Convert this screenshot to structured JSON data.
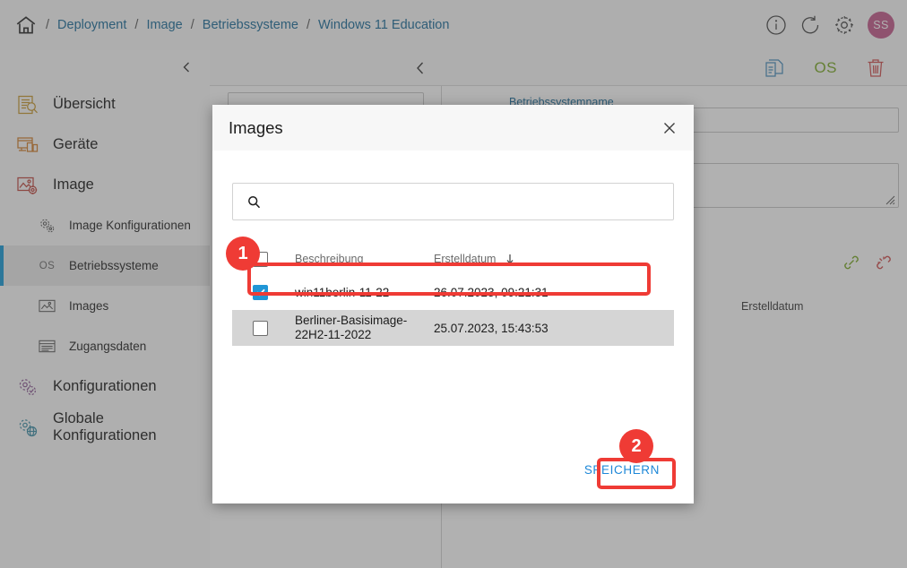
{
  "breadcrumb": {
    "home_icon": "home-icon",
    "separator": "/",
    "items": [
      {
        "label": "Deployment"
      },
      {
        "label": "Image"
      },
      {
        "label": "Betriebssysteme"
      },
      {
        "label": "Windows 11 Education"
      }
    ]
  },
  "topbar": {
    "icons": [
      {
        "name": "info-icon"
      },
      {
        "name": "refresh-icon"
      },
      {
        "name": "gear-icon"
      }
    ],
    "avatar_initials": "SS",
    "avatar_color": "#c45d8d"
  },
  "sidebar": {
    "collapse_icon": "chevron-left-icon",
    "items": [
      {
        "label": "Übersicht",
        "icon": "document-search-icon",
        "level": 1,
        "active": false
      },
      {
        "label": "Geräte",
        "icon": "devices-icon",
        "level": 1,
        "active": false
      },
      {
        "label": "Image",
        "icon": "image-gear-icon",
        "level": 1,
        "active": false
      },
      {
        "label": "Image Konfigurationen",
        "icon": "gears-icon",
        "level": 2,
        "active": false
      },
      {
        "label": "Betriebssysteme",
        "icon": "os-text-icon",
        "level": 2,
        "active": true
      },
      {
        "label": "Images",
        "icon": "image-icon",
        "level": 2,
        "active": false
      },
      {
        "label": "Zugangsdaten",
        "icon": "credentials-icon",
        "level": 2,
        "active": false
      },
      {
        "label": "Konfigurationen",
        "icon": "config-gear-icon",
        "level": 1,
        "active": false
      },
      {
        "label": "Globale Konfigurationen",
        "icon": "global-config-icon",
        "level": 1,
        "active": false
      }
    ]
  },
  "background_panel": {
    "back_icon": "chevron-left-icon",
    "toolbar_icons": [
      {
        "name": "copy-document-icon",
        "color": "#4a90bf"
      },
      {
        "name": "os-label",
        "label": "OS",
        "color": "#7cab2a"
      },
      {
        "name": "delete-trash-icon",
        "color": "#d05252"
      }
    ],
    "field_label": "Betriebssystemname",
    "link_icons": [
      {
        "name": "link-icon",
        "color": "#7cab2a"
      },
      {
        "name": "unlink-icon",
        "color": "#d05252"
      }
    ],
    "erstelldatum_label": "Erstelldatum"
  },
  "modal": {
    "title": "Images",
    "close_icon": "close-icon",
    "search": {
      "icon": "search-icon",
      "value": "",
      "placeholder": ""
    },
    "table": {
      "columns": [
        {
          "key": "check",
          "label": ""
        },
        {
          "key": "desc",
          "label": "Beschreibung"
        },
        {
          "key": "date",
          "label": "Erstelldatum"
        }
      ],
      "sort": {
        "column": "Erstelldatum",
        "direction": "descending",
        "icon": "arrow-down-icon"
      },
      "header_checkbox_checked": false,
      "rows": [
        {
          "checked": true,
          "description": "win11berlin-11-22",
          "created": "26.07.2023, 09:21:31",
          "highlighted": true
        },
        {
          "checked": false,
          "description": "Berliner-Basisimage-22H2-11-2022",
          "created": "25.07.2023, 15:43:53",
          "highlighted": false
        }
      ]
    },
    "save_label": "SPEICHERN"
  },
  "annotations": [
    {
      "badge": "1",
      "target": "selected-image-row",
      "color": "#ef3b35"
    },
    {
      "badge": "2",
      "target": "save-button",
      "color": "#ef3b35"
    }
  ],
  "colors": {
    "accent_blue": "#1e88d8",
    "link_blue": "#1f6f9c",
    "annotation_red": "#ef3b35",
    "checkbox_blue": "#2196d6",
    "sidebar_active": "#ebebeb"
  }
}
